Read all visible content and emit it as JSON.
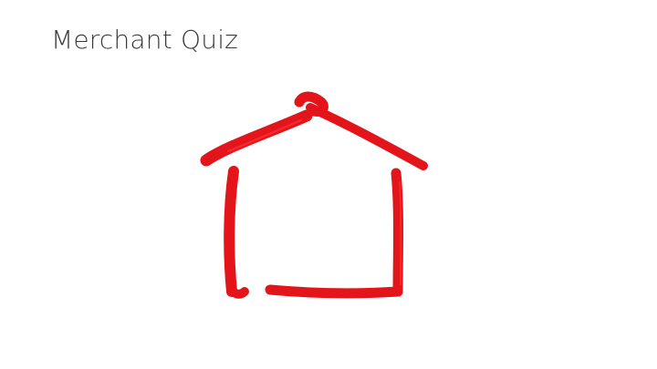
{
  "slide": {
    "title": "Merchant Quiz"
  },
  "drawing": {
    "icon": "house-icon",
    "stroke_color": "#e3141a",
    "highlight_color": "#ff3a3f"
  }
}
